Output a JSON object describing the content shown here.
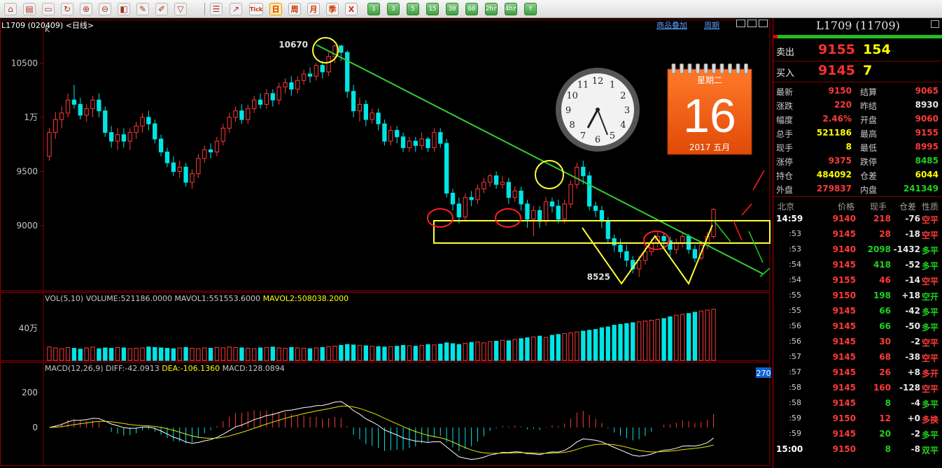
{
  "toolbar": {
    "icons": [
      "home-icon",
      "book-icon",
      "screen-icon",
      "refresh-icon",
      "zoom-in-icon",
      "zoom-out-icon",
      "layers-icon",
      "pen-icon",
      "pencil-icon",
      "filter-icon"
    ],
    "chart_icons": [
      "list-icon",
      "trend-icon"
    ],
    "tick_label": "Tick",
    "periods": [
      "日",
      "周",
      "月",
      "季",
      "X"
    ],
    "active_period": "日",
    "minutes": [
      "1",
      "3",
      "5",
      "15",
      "30",
      "60",
      "2hr",
      "4hr",
      "Y"
    ]
  },
  "chart": {
    "instrument": "L1709 (020409) <日线>",
    "k_label": "K",
    "overlay_link": "商品叠加",
    "period_link": "周期",
    "price_axis": [
      "10500",
      "1万",
      "9500",
      "9000"
    ],
    "high_label": "10670",
    "low_label": "8525",
    "vol_header": {
      "main": "VOL(5,10) VOLUME:521186.0000 MAVOL1:551553.6000 ",
      "ma2": "MAVOL2:508038.2000"
    },
    "vol_axis": [
      "40万"
    ],
    "macd_header": {
      "main": "MACD(12,26,9) DIFF:-42.0913 ",
      "dea": "DEA:-106.1360",
      "macd": " MACD:128.0894"
    },
    "macd_axis": [
      "200",
      "0"
    ],
    "macd_badge": "270"
  },
  "clock": {
    "numbers": [
      "12",
      "1",
      "2",
      "3",
      "4",
      "5",
      "6",
      "7",
      "8",
      "9",
      "10",
      "11"
    ]
  },
  "calendar": {
    "weekday": "星期二",
    "day": "16",
    "month": "2017 五月"
  },
  "quote": {
    "title": "L1709 (11709)",
    "ask": {
      "label": "卖出",
      "price": "9155",
      "volume": "154"
    },
    "bid": {
      "label": "买入",
      "price": "9145",
      "volume": "7"
    },
    "stats": [
      {
        "l1": "最新",
        "v1": "9150",
        "c1": "red",
        "l2": "结算",
        "v2": "9065",
        "c2": "red"
      },
      {
        "l1": "涨跌",
        "v1": "220",
        "c1": "red",
        "l2": "昨结",
        "v2": "8930",
        "c2": "white"
      },
      {
        "l1": "幅度",
        "v1": "2.46%",
        "c1": "red",
        "l2": "开盘",
        "v2": "9060",
        "c2": "red"
      },
      {
        "l1": "总手",
        "v1": "521186",
        "c1": "yellow",
        "l2": "最高",
        "v2": "9155",
        "c2": "red"
      },
      {
        "l1": "现手",
        "v1": "8",
        "c1": "yellow",
        "l2": "最低",
        "v2": "8995",
        "c2": "red"
      },
      {
        "l1": "涨停",
        "v1": "9375",
        "c1": "red",
        "l2": "跌停",
        "v2": "8485",
        "c2": "green"
      },
      {
        "l1": "持仓",
        "v1": "484092",
        "c1": "yellow",
        "l2": "仓差",
        "v2": "6044",
        "c2": "yellow"
      },
      {
        "l1": "外盘",
        "v1": "279837",
        "c1": "red",
        "l2": "内盘",
        "v2": "241349",
        "c2": "green"
      }
    ],
    "tick_header": {
      "time": "北京",
      "price": "价格",
      "vol": "现手",
      "chg": "仓差",
      "type": "性质"
    },
    "ticks": [
      {
        "time": "14:59",
        "price": "9140",
        "vol": "218",
        "chg": "-76",
        "type": "空平",
        "pc": "red",
        "vc": "red",
        "tc": "red"
      },
      {
        "time": ":53",
        "price": "9145",
        "vol": "28",
        "chg": "-18",
        "type": "空平",
        "pc": "red",
        "vc": "red",
        "tc": "red"
      },
      {
        "time": ":53",
        "price": "9140",
        "vol": "2098",
        "chg": "-1432",
        "type": "多平",
        "pc": "red",
        "vc": "green",
        "tc": "green"
      },
      {
        "time": ":54",
        "price": "9145",
        "vol": "418",
        "chg": "-52",
        "type": "多平",
        "pc": "red",
        "vc": "green",
        "tc": "green"
      },
      {
        "time": ":54",
        "price": "9155",
        "vol": "46",
        "chg": "-14",
        "type": "空平",
        "pc": "red",
        "vc": "red",
        "tc": "red"
      },
      {
        "time": ":55",
        "price": "9150",
        "vol": "198",
        "chg": "+18",
        "type": "空开",
        "pc": "red",
        "vc": "green",
        "tc": "green"
      },
      {
        "time": ":55",
        "price": "9145",
        "vol": "66",
        "chg": "-42",
        "type": "多平",
        "pc": "red",
        "vc": "green",
        "tc": "green"
      },
      {
        "time": ":56",
        "price": "9145",
        "vol": "66",
        "chg": "-50",
        "type": "多平",
        "pc": "red",
        "vc": "green",
        "tc": "green"
      },
      {
        "time": ":56",
        "price": "9145",
        "vol": "30",
        "chg": "-2",
        "type": "空平",
        "pc": "red",
        "vc": "red",
        "tc": "red"
      },
      {
        "time": ":57",
        "price": "9145",
        "vol": "68",
        "chg": "-38",
        "type": "空平",
        "pc": "red",
        "vc": "red",
        "tc": "red"
      },
      {
        "time": ":57",
        "price": "9145",
        "vol": "26",
        "chg": "+8",
        "type": "多开",
        "pc": "red",
        "vc": "red",
        "tc": "red"
      },
      {
        "time": ":58",
        "price": "9145",
        "vol": "160",
        "chg": "-128",
        "type": "空平",
        "pc": "red",
        "vc": "red",
        "tc": "red"
      },
      {
        "time": ":58",
        "price": "9145",
        "vol": "8",
        "chg": "-4",
        "type": "多平",
        "pc": "red",
        "vc": "green",
        "tc": "green"
      },
      {
        "time": ":59",
        "price": "9150",
        "vol": "12",
        "chg": "+0",
        "type": "多换",
        "pc": "red",
        "vc": "red",
        "tc": "red"
      },
      {
        "time": ":59",
        "price": "9145",
        "vol": "20",
        "chg": "-2",
        "type": "多平",
        "pc": "red",
        "vc": "green",
        "tc": "green"
      },
      {
        "time": "15:00",
        "price": "9150",
        "vol": "8",
        "chg": "-8",
        "type": "双平",
        "pc": "red",
        "vc": "green",
        "tc": "green"
      }
    ]
  },
  "colors": {
    "up": "#ff3a3a",
    "down": "#00e5e5",
    "grid": "#8b0000",
    "trendline": "#33cc33",
    "highlight": "#ffff33"
  },
  "chart_data": {
    "type": "candlestick",
    "price_ticks": [
      9000,
      9500,
      10000,
      10500
    ],
    "high": 10670,
    "low": 8525,
    "candles": [
      [
        9640,
        9860,
        9600,
        9900
      ],
      [
        9860,
        9980,
        9800,
        10050
      ],
      [
        9980,
        10040,
        9900,
        10100
      ],
      [
        10040,
        10160,
        10000,
        10220
      ],
      [
        10160,
        10120,
        10080,
        10300
      ],
      [
        10120,
        10020,
        9980,
        10180
      ],
      [
        10020,
        10080,
        9960,
        10120
      ],
      [
        10080,
        10160,
        10000,
        10200
      ],
      [
        10160,
        10060,
        10000,
        10220
      ],
      [
        10060,
        9860,
        9820,
        10100
      ],
      [
        9860,
        9780,
        9720,
        9920
      ],
      [
        9780,
        9840,
        9700,
        9900
      ],
      [
        9840,
        9780,
        9720,
        9900
      ],
      [
        9780,
        9860,
        9700,
        9900
      ],
      [
        9860,
        9920,
        9800,
        9960
      ],
      [
        9920,
        10000,
        9860,
        10040
      ],
      [
        10000,
        9940,
        9880,
        10060
      ],
      [
        9940,
        9800,
        9760,
        9980
      ],
      [
        9800,
        9680,
        9640,
        9840
      ],
      [
        9680,
        9580,
        9540,
        9720
      ],
      [
        9580,
        9500,
        9460,
        9640
      ],
      [
        9500,
        9540,
        9440,
        9600
      ],
      [
        9540,
        9400,
        9360,
        9580
      ],
      [
        9400,
        9480,
        9340,
        9520
      ],
      [
        9480,
        9620,
        9440,
        9660
      ],
      [
        9620,
        9700,
        9580,
        9740
      ],
      [
        9700,
        9680,
        9620,
        9760
      ],
      [
        9680,
        9780,
        9640,
        9820
      ],
      [
        9780,
        9900,
        9740,
        9940
      ],
      [
        9900,
        10000,
        9860,
        10040
      ],
      [
        10000,
        10060,
        9960,
        10100
      ],
      [
        10060,
        9980,
        9940,
        10120
      ],
      [
        9980,
        10080,
        9940,
        10120
      ],
      [
        10080,
        10160,
        10040,
        10200
      ],
      [
        10160,
        10120,
        10080,
        10220
      ],
      [
        10120,
        10220,
        10080,
        10260
      ],
      [
        10220,
        10160,
        10100,
        10260
      ],
      [
        10160,
        10280,
        10120,
        10320
      ],
      [
        10280,
        10320,
        10220,
        10360
      ],
      [
        10320,
        10260,
        10200,
        10380
      ],
      [
        10260,
        10340,
        10220,
        10380
      ],
      [
        10340,
        10400,
        10300,
        10440
      ],
      [
        10400,
        10380,
        10320,
        10460
      ],
      [
        10380,
        10480,
        10340,
        10500
      ],
      [
        10480,
        10420,
        10360,
        10520
      ],
      [
        10420,
        10560,
        10380,
        10600
      ],
      [
        10560,
        10660,
        10500,
        10670
      ],
      [
        10660,
        10600,
        10520,
        10670
      ],
      [
        10600,
        10240,
        10180,
        10620
      ],
      [
        10240,
        10060,
        10000,
        10300
      ],
      [
        10060,
        10120,
        9960,
        10180
      ],
      [
        10120,
        9980,
        9920,
        10160
      ],
      [
        9980,
        10040,
        9940,
        10080
      ],
      [
        10040,
        9940,
        9880,
        10080
      ],
      [
        9940,
        9780,
        9740,
        9980
      ],
      [
        9780,
        9880,
        9740,
        9920
      ],
      [
        9880,
        9820,
        9760,
        9920
      ],
      [
        9820,
        9720,
        9680,
        9860
      ],
      [
        9720,
        9780,
        9680,
        9820
      ],
      [
        9780,
        9740,
        9680,
        9820
      ],
      [
        9740,
        9800,
        9700,
        9860
      ],
      [
        9800,
        9720,
        9680,
        9820
      ],
      [
        9720,
        9860,
        9680,
        9900
      ],
      [
        9860,
        9760,
        9720,
        9900
      ],
      [
        9760,
        9300,
        9260,
        9800
      ],
      [
        9300,
        9200,
        9140,
        9340
      ],
      [
        9200,
        9080,
        9020,
        9260
      ],
      [
        9080,
        9260,
        9040,
        9300
      ],
      [
        9260,
        9240,
        9180,
        9320
      ],
      [
        9240,
        9340,
        9200,
        9380
      ],
      [
        9340,
        9400,
        9300,
        9440
      ],
      [
        9400,
        9460,
        9360,
        9480
      ],
      [
        9460,
        9380,
        9340,
        9500
      ],
      [
        9380,
        9400,
        9340,
        9460
      ],
      [
        9400,
        9260,
        9200,
        9440
      ],
      [
        9260,
        9320,
        9220,
        9360
      ],
      [
        9320,
        9200,
        9140,
        9360
      ],
      [
        9200,
        9060,
        8980,
        9240
      ],
      [
        9060,
        9140,
        8900,
        9180
      ],
      [
        9140,
        9040,
        8980,
        9180
      ],
      [
        9040,
        9220,
        9000,
        9260
      ],
      [
        9220,
        9180,
        9120,
        9260
      ],
      [
        9180,
        9060,
        9020,
        9240
      ],
      [
        9060,
        9200,
        9020,
        9240
      ],
      [
        9200,
        9380,
        9160,
        9420
      ],
      [
        9380,
        9540,
        9340,
        9580
      ],
      [
        9540,
        9460,
        9380,
        9600
      ],
      [
        9460,
        9180,
        9140,
        9500
      ],
      [
        9180,
        9140,
        9080,
        9220
      ],
      [
        9140,
        9040,
        8980,
        9180
      ],
      [
        9040,
        8880,
        8840,
        9080
      ],
      [
        8880,
        8820,
        8760,
        8920
      ],
      [
        8820,
        8760,
        8700,
        8880
      ],
      [
        8760,
        8680,
        8620,
        8820
      ],
      [
        8680,
        8600,
        8560,
        8720
      ],
      [
        8600,
        8680,
        8525,
        8720
      ],
      [
        8680,
        8760,
        8640,
        8800
      ],
      [
        8760,
        8840,
        8720,
        8880
      ],
      [
        8840,
        8900,
        8800,
        8940
      ],
      [
        8900,
        8860,
        8800,
        8940
      ],
      [
        8860,
        8780,
        8720,
        8900
      ],
      [
        8780,
        8840,
        8740,
        8880
      ],
      [
        8840,
        8900,
        8800,
        8940
      ],
      [
        8900,
        8780,
        8740,
        8920
      ],
      [
        8780,
        8700,
        8660,
        8820
      ],
      [
        8700,
        8820,
        8680,
        8860
      ],
      [
        8820,
        8900,
        8780,
        8940
      ],
      [
        8900,
        9150,
        8880,
        9160
      ]
    ],
    "volumes": [
      32,
      30,
      28,
      31,
      29,
      27,
      30,
      32,
      28,
      30,
      29,
      31,
      30,
      28,
      29,
      30,
      32,
      31,
      30,
      29,
      28,
      30,
      31,
      29,
      28,
      30,
      29,
      31,
      30,
      32,
      31,
      30,
      29,
      28,
      30,
      31,
      32,
      30,
      29,
      31,
      30,
      29,
      28,
      30,
      31,
      33,
      34,
      36,
      38,
      37,
      36,
      35,
      34,
      33,
      32,
      33,
      34,
      36,
      35,
      34,
      36,
      38,
      37,
      39,
      42,
      40,
      38,
      41,
      43,
      44,
      42,
      45,
      46,
      48,
      47,
      50,
      52,
      54,
      56,
      58,
      55,
      60,
      62,
      64,
      66,
      68,
      70,
      72,
      74,
      78,
      80,
      84,
      86,
      88,
      90,
      92,
      94,
      96,
      98,
      100,
      104,
      108,
      110,
      112,
      115,
      118,
      120,
      122
    ],
    "vol_ylabel": "40万",
    "macd": {
      "diff": -42.0913,
      "dea": -106.136,
      "macd": 128.0894,
      "ticks": [
        0,
        200
      ]
    }
  }
}
